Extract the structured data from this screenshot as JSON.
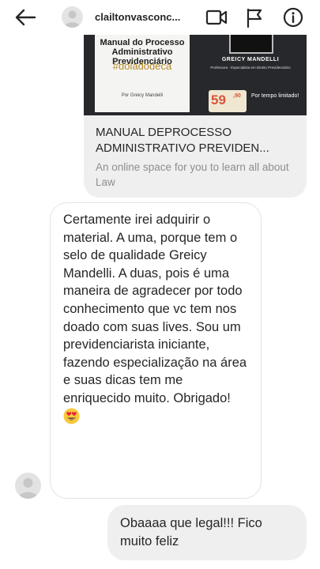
{
  "header": {
    "username": "clailtonvasconc..."
  },
  "shared_link": {
    "image": {
      "book_title": "Manual do Processo Administrativo Previdenciário",
      "book_hashtag": "#doladodeca",
      "book_author": "Por Greicy Mandelli",
      "promo_name": "GREICY MANDELLI",
      "promo_role": "Professora - Especialista em Direito Previdenciário",
      "price_whole": "59",
      "price_cents": ",90",
      "price_note": "Por tempo limitado!"
    },
    "title_line1": "MANUAL DEPROCESSO",
    "title_line2": "ADMINISTRATIVO PREVIDEN...",
    "description": "An online space for you to learn all about Law"
  },
  "messages": {
    "received": {
      "text": "Certamente irei adquirir o material. A uma, porque tem o selo de qualidade Greicy Mandelli. A duas, pois é uma maneira de agradecer por todo conhecimento que vc tem nos doado com suas lives. Sou um previdenciarista iniciante, fazendo especialização na área e suas dicas tem me enriquecido muito. Obrigado!",
      "emoji": "heart-eyes-emoji"
    },
    "sent": {
      "text": "Obaaaa que legal!!! Fico muito feliz"
    }
  },
  "colors": {
    "bubble_gray": "#efefef",
    "text_primary": "#262626",
    "text_secondary": "#8e8e8e",
    "promo_dark": "#26282b",
    "price_red": "#d8553a"
  },
  "icons": [
    "back-arrow-icon",
    "video-call-icon",
    "flag-icon",
    "info-icon"
  ]
}
